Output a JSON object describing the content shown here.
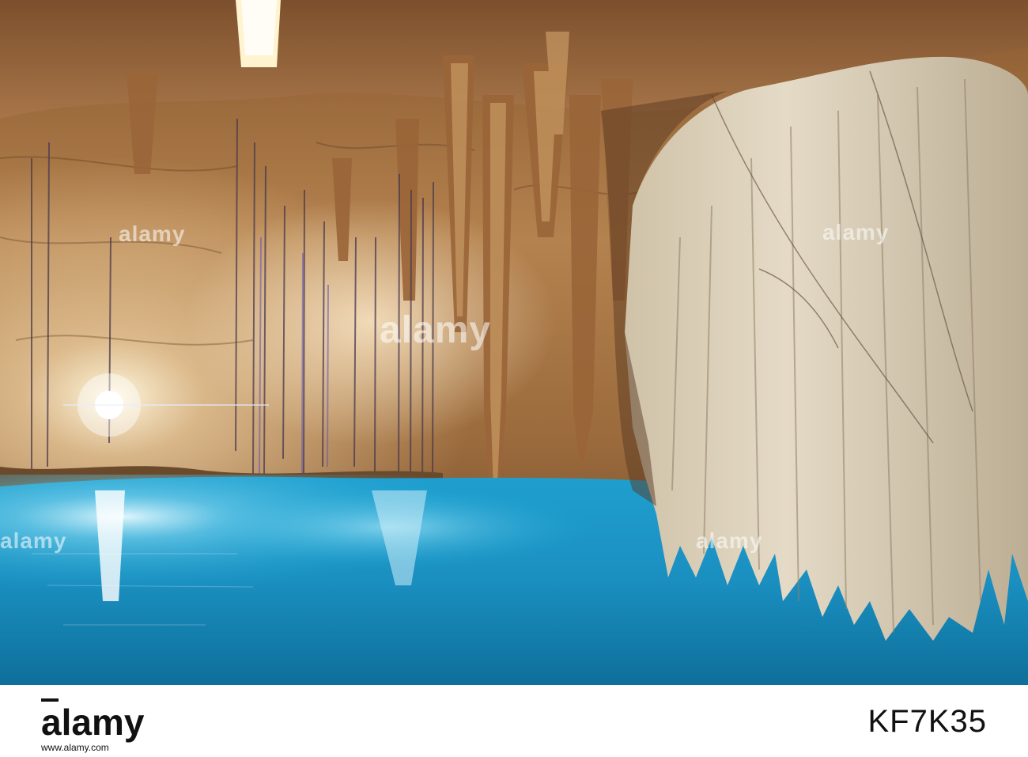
{
  "photo": {
    "subject": "cenote-cave-pool",
    "colors": {
      "water": "#1aa8d6",
      "water_deep": "#0b5f8a",
      "rock": "#b07a45",
      "rock_light": "#d9b68a",
      "formation": "#d8ccb6",
      "sunbeam": "#fff6d8"
    }
  },
  "watermark": {
    "text": "alamy"
  },
  "footer": {
    "logo": "alamy",
    "image_id": "KF7K35",
    "site": "www.alamy.com"
  }
}
